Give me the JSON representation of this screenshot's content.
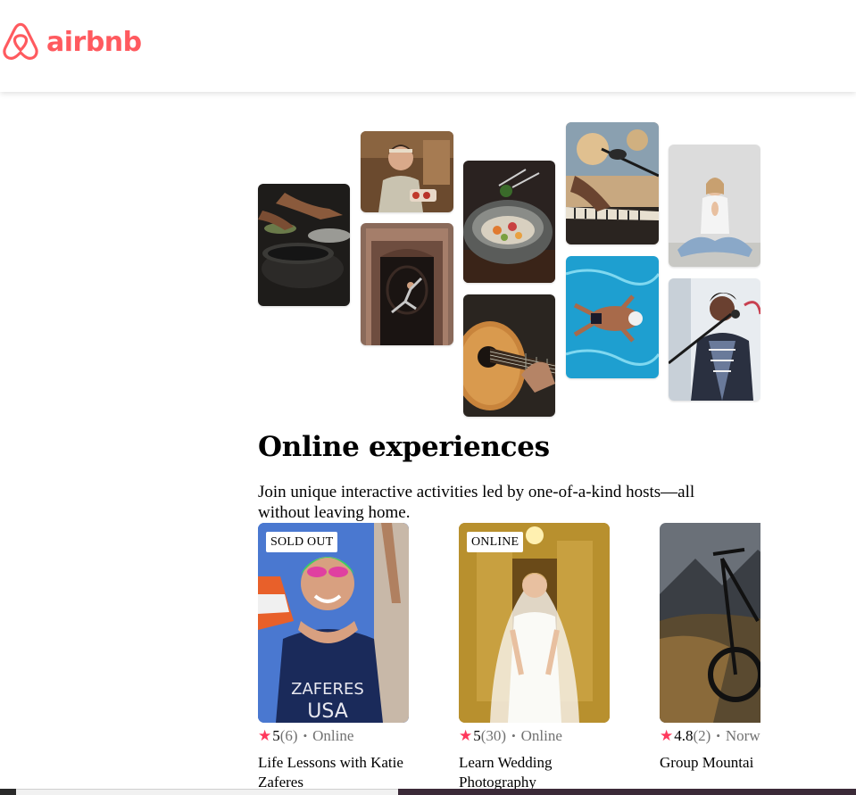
{
  "brand": {
    "name": "airbnb",
    "color": "#ff5a5f"
  },
  "mosaic": [
    {
      "name": "photo-cooking-pans",
      "subject": "hands cooking with pans"
    },
    {
      "name": "photo-baker-woman",
      "subject": "woman holding pastry"
    },
    {
      "name": "photo-dancer-doorway",
      "subject": "dancer in ornate doorway"
    },
    {
      "name": "photo-food-bowl",
      "subject": "plated dish in stone bowl"
    },
    {
      "name": "photo-guitar",
      "subject": "acoustic guitar"
    },
    {
      "name": "photo-piano-microphone",
      "subject": "keyboard and microphone"
    },
    {
      "name": "photo-swimmer",
      "subject": "swimmer in pool"
    },
    {
      "name": "photo-yoga",
      "subject": "woman meditating"
    },
    {
      "name": "photo-singer",
      "subject": "singer with microphone"
    }
  ],
  "section": {
    "title": "Online experiences",
    "subtitle": "Join unique interactive activities led by one-of-a-kind hosts—all without leaving home."
  },
  "cards": [
    {
      "badge": "SOLD OUT",
      "rating": "5",
      "count": "(6)",
      "location": "Online",
      "title": "Life Lessons with Katie Zaferes",
      "jersey_line1": "ZAFERES",
      "jersey_line2": "USA"
    },
    {
      "badge": "ONLINE",
      "rating": "5",
      "count": "(30)",
      "location": "Online",
      "title": "Learn Wedding Photography"
    },
    {
      "badge": "",
      "rating": "4.8",
      "count": "(2)",
      "location": "Norw",
      "title": "Group Mountai"
    }
  ],
  "colors": {
    "star": "#ff385c",
    "muted": "#717171"
  }
}
